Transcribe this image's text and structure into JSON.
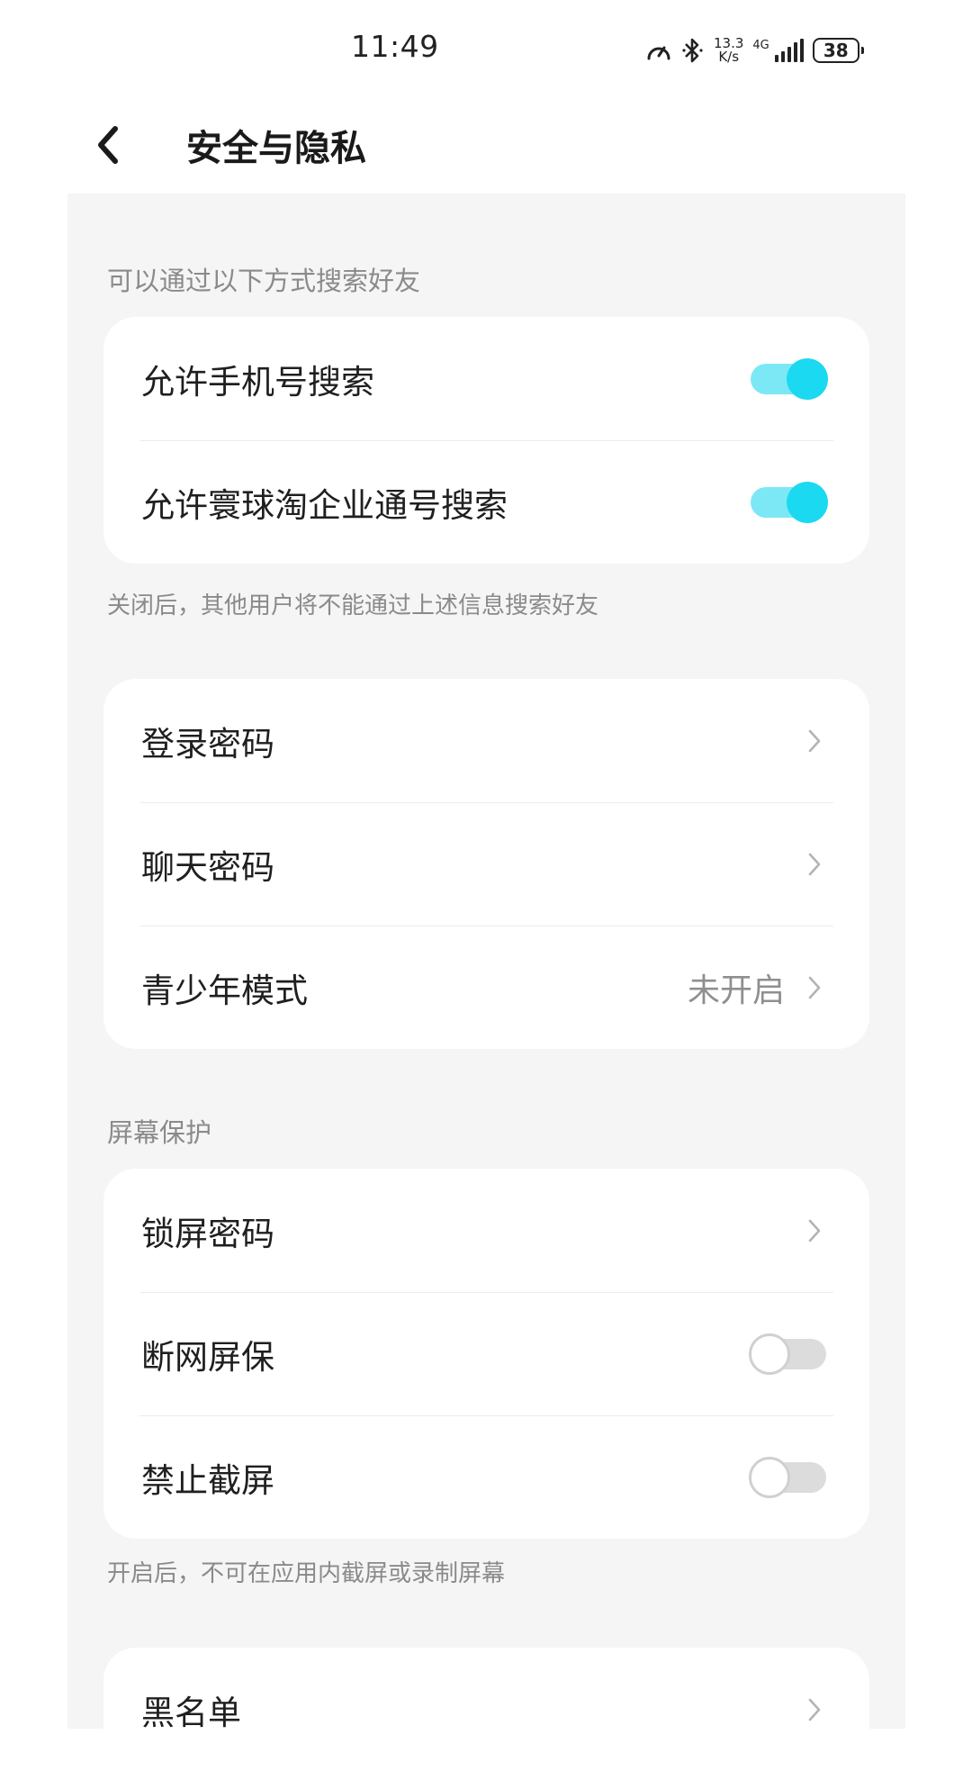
{
  "status_bar": {
    "time": "11:49",
    "net_speed_value": "13.3",
    "net_speed_unit": "K/s",
    "network_type": "4G",
    "battery_level": "38"
  },
  "header": {
    "title": "安全与隐私"
  },
  "search_section": {
    "label": "可以通过以下方式搜索好友",
    "items": [
      {
        "label": "允许手机号搜索",
        "enabled": true
      },
      {
        "label": "允许寰球淘企业通号搜索",
        "enabled": true
      }
    ],
    "hint": "关闭后，其他用户将不能通过上述信息搜索好友"
  },
  "password_section": {
    "items": [
      {
        "label": "登录密码"
      },
      {
        "label": "聊天密码"
      },
      {
        "label": "青少年模式",
        "value": "未开启"
      }
    ]
  },
  "screen_section": {
    "label": "屏幕保护",
    "items": [
      {
        "label": "锁屏密码"
      },
      {
        "label": "断网屏保",
        "enabled": false
      },
      {
        "label": "禁止截屏",
        "enabled": false
      }
    ],
    "hint": "开启后，不可在应用内截屏或录制屏幕"
  },
  "blacklist_section": {
    "items": [
      {
        "label": "黑名单"
      }
    ]
  },
  "colors": {
    "toggle_on_track": "#7ce8f6",
    "toggle_on_knob": "#1bd9f0",
    "background": "#f5f5f5"
  }
}
